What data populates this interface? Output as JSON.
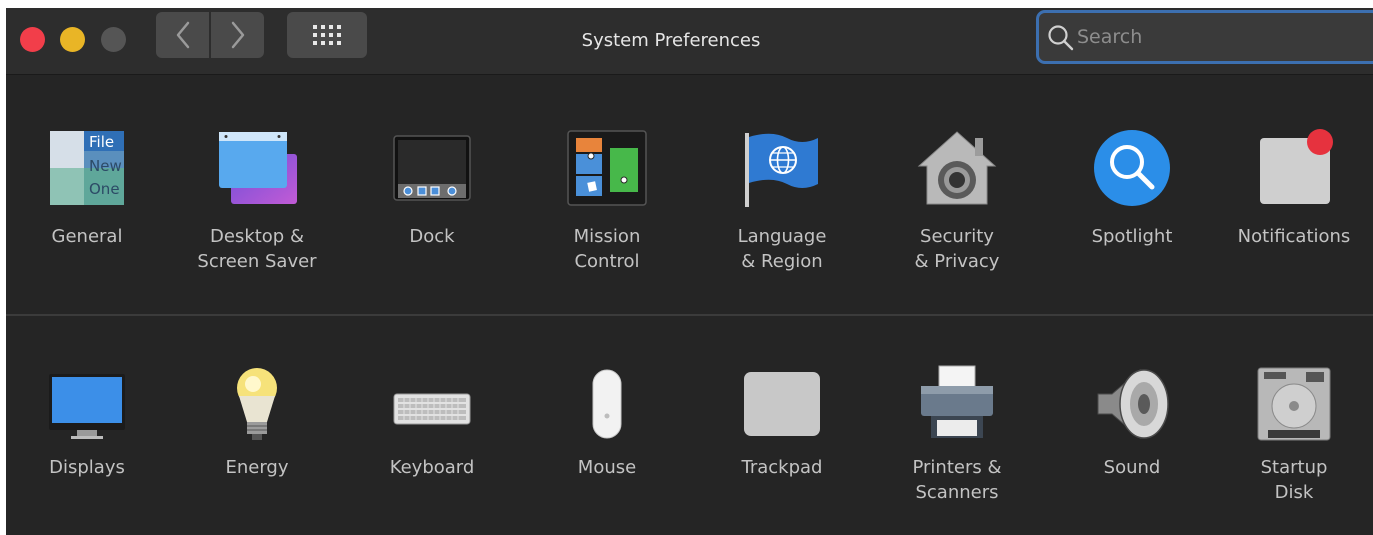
{
  "window": {
    "title": "System Preferences",
    "controls": {
      "close": "close-button",
      "minimize": "minimize-button",
      "zoom": "zoom-button"
    }
  },
  "toolbar": {
    "back_icon": "chevron-left-icon",
    "forward_icon": "chevron-right-icon",
    "show_all_icon": "grid-icon"
  },
  "search": {
    "placeholder": "Search",
    "value": ""
  },
  "rows": [
    {
      "panes": [
        {
          "id": "general",
          "label": "General",
          "icon": "general-icon",
          "icon_text": [
            "File",
            "New",
            "One"
          ]
        },
        {
          "id": "desktop",
          "label": "Desktop &\nScreen Saver",
          "icon": "desktop-screensaver-icon"
        },
        {
          "id": "dock",
          "label": "Dock",
          "icon": "dock-icon"
        },
        {
          "id": "mission-control",
          "label": "Mission\nControl",
          "icon": "mission-control-icon"
        },
        {
          "id": "language",
          "label": "Language\n& Region",
          "icon": "globe-flag-icon"
        },
        {
          "id": "security",
          "label": "Security\n& Privacy",
          "icon": "house-lock-icon"
        },
        {
          "id": "spotlight",
          "label": "Spotlight",
          "icon": "magnifier-icon"
        },
        {
          "id": "notifications",
          "label": "Notifications",
          "icon": "notifications-icon"
        }
      ]
    },
    {
      "panes": [
        {
          "id": "displays",
          "label": "Displays",
          "icon": "monitor-icon"
        },
        {
          "id": "energy",
          "label": "Energy",
          "icon": "lightbulb-icon"
        },
        {
          "id": "keyboard",
          "label": "Keyboard",
          "icon": "keyboard-icon"
        },
        {
          "id": "mouse",
          "label": "Mouse",
          "icon": "mouse-icon"
        },
        {
          "id": "trackpad",
          "label": "Trackpad",
          "icon": "trackpad-icon"
        },
        {
          "id": "printers",
          "label": "Printers &\nScanners",
          "icon": "printer-icon"
        },
        {
          "id": "sound",
          "label": "Sound",
          "icon": "speaker-icon"
        },
        {
          "id": "startup-disk",
          "label": "Startup\nDisk",
          "icon": "hard-disk-icon"
        }
      ]
    }
  ],
  "colors": {
    "background": "#252525",
    "titlebar": "#2d2d2d",
    "close": "#f23e4a",
    "minimize": "#e9b526",
    "zoom_disabled": "#555555",
    "search_focus": "#3c6fb0",
    "label": "#c3c3c3"
  }
}
